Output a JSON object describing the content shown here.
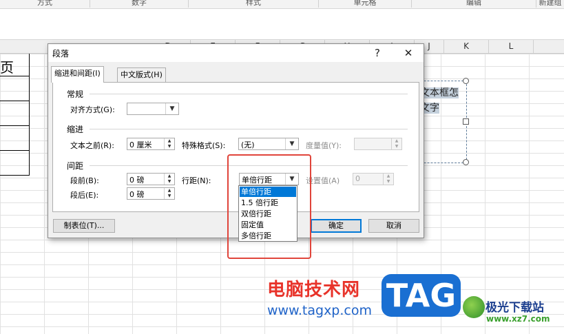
{
  "ribbon": {
    "groups": [
      "方式",
      "数字",
      "样式",
      "单元格",
      "编辑",
      "新建组"
    ]
  },
  "sheet": {
    "columns": [
      "D",
      "E",
      "F",
      "G",
      "H",
      "I",
      "J",
      "K",
      "L"
    ],
    "row_char": "页",
    "textbox_line1": "文本框怎",
    "textbox_line2": "文字"
  },
  "dialog": {
    "title": "段落",
    "help": "?",
    "close": "✕",
    "tabs": [
      {
        "label": "缩进和间距(I)",
        "active": true
      },
      {
        "label": "中文版式(H)",
        "active": false
      }
    ],
    "general": {
      "heading": "常规",
      "alignment_label": "对齐方式(G):",
      "alignment_value": ""
    },
    "indent": {
      "heading": "缩进",
      "before_text_label": "文本之前(R):",
      "before_text_value": "0 厘米",
      "special_label": "特殊格式(S):",
      "special_value": "(无)",
      "measure_label": "度量值(Y):",
      "measure_value": ""
    },
    "spacing": {
      "heading": "间距",
      "before_label": "段前(B):",
      "before_value": "0 磅",
      "after_label": "段后(E):",
      "after_value": "0 磅",
      "line_spacing_label": "行距(N):",
      "line_spacing_value": "单倍行距",
      "set_value_label": "设置值(A)",
      "set_value": "0"
    },
    "line_spacing_options": [
      "单倍行距",
      "1.5 倍行距",
      "双倍行距",
      "固定值",
      "多倍行距"
    ],
    "tab_stops_button": "制表位(T)...",
    "ok_button": "确定",
    "cancel_button": "取消"
  },
  "watermark": {
    "site_name": "电脑技术网",
    "site_url": "www.tagxp.com",
    "badge": "TAG",
    "logo_text": "极光下载站",
    "logo_url": "www.xz7.com"
  },
  "colors": {
    "accent": "#0078d7",
    "highlight_box": "#e0443a"
  }
}
